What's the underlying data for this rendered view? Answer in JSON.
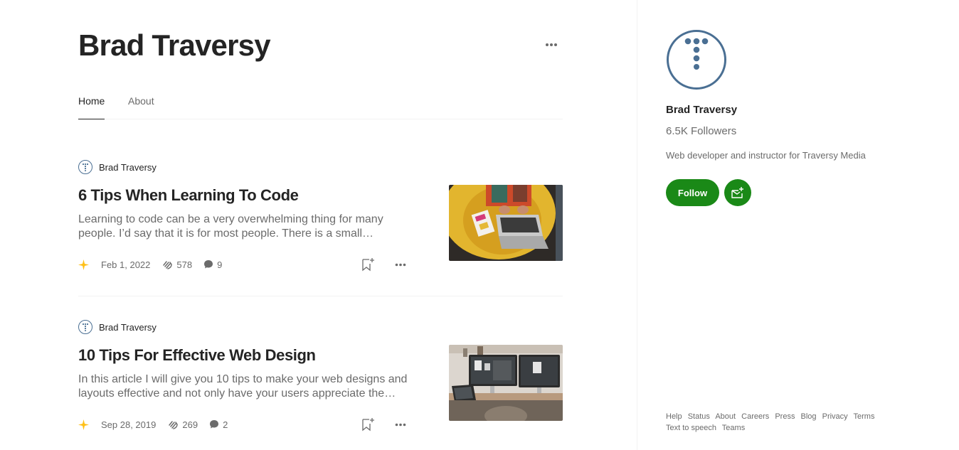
{
  "profile": {
    "name": "Brad Traversy"
  },
  "tabs": [
    {
      "label": "Home",
      "active": true
    },
    {
      "label": "About",
      "active": false
    }
  ],
  "articles": [
    {
      "author": "Brad Traversy",
      "title": "6 Tips When Learning To Code",
      "excerpt": "Learning to code can be a very overwhelming thing for many people. I’d say that it is for most people. There is a small…",
      "date": "Feb 1, 2022",
      "claps": "578",
      "comments": "9"
    },
    {
      "author": "Brad Traversy",
      "title": "10 Tips For Effective Web Design",
      "excerpt": "In this article I will give you 10 tips to make your web designs and layouts effective and not only have your users appreciate the…",
      "date": "Sep 28, 2019",
      "claps": "269",
      "comments": "2"
    }
  ],
  "sidebar": {
    "name": "Brad Traversy",
    "followers": "6.5K Followers",
    "bio": "Web developer and instructor for Traversy Media",
    "follow_label": "Follow"
  },
  "footer": {
    "links": [
      "Help",
      "Status",
      "About",
      "Careers",
      "Press",
      "Blog",
      "Privacy",
      "Terms",
      "Text to speech",
      "Teams"
    ]
  },
  "colors": {
    "accent_green": "#1a8917",
    "avatar_blue": "#4a6f93",
    "star_yellow": "#ffc017",
    "text_primary": "#242424",
    "text_secondary": "#6b6b6b"
  },
  "icons": [
    "more-horizontal-icon",
    "t-avatar-icon",
    "star-icon",
    "clap-icon",
    "comment-icon",
    "bookmark-add-icon",
    "subscribe-mail-icon"
  ]
}
